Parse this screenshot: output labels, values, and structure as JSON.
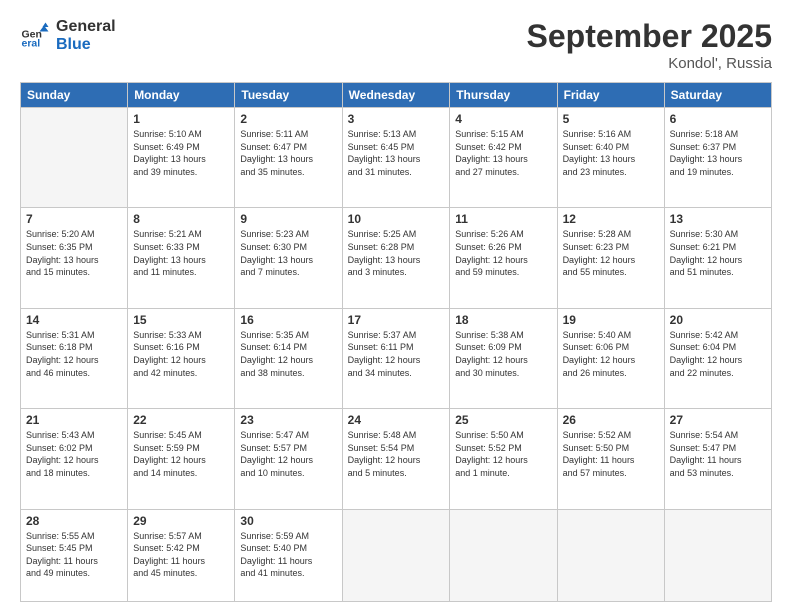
{
  "header": {
    "logo_general": "General",
    "logo_blue": "Blue",
    "month": "September 2025",
    "location": "Kondol', Russia"
  },
  "weekdays": [
    "Sunday",
    "Monday",
    "Tuesday",
    "Wednesday",
    "Thursday",
    "Friday",
    "Saturday"
  ],
  "weeks": [
    [
      {
        "day": "",
        "info": ""
      },
      {
        "day": "1",
        "info": "Sunrise: 5:10 AM\nSunset: 6:49 PM\nDaylight: 13 hours\nand 39 minutes."
      },
      {
        "day": "2",
        "info": "Sunrise: 5:11 AM\nSunset: 6:47 PM\nDaylight: 13 hours\nand 35 minutes."
      },
      {
        "day": "3",
        "info": "Sunrise: 5:13 AM\nSunset: 6:45 PM\nDaylight: 13 hours\nand 31 minutes."
      },
      {
        "day": "4",
        "info": "Sunrise: 5:15 AM\nSunset: 6:42 PM\nDaylight: 13 hours\nand 27 minutes."
      },
      {
        "day": "5",
        "info": "Sunrise: 5:16 AM\nSunset: 6:40 PM\nDaylight: 13 hours\nand 23 minutes."
      },
      {
        "day": "6",
        "info": "Sunrise: 5:18 AM\nSunset: 6:37 PM\nDaylight: 13 hours\nand 19 minutes."
      }
    ],
    [
      {
        "day": "7",
        "info": "Sunrise: 5:20 AM\nSunset: 6:35 PM\nDaylight: 13 hours\nand 15 minutes."
      },
      {
        "day": "8",
        "info": "Sunrise: 5:21 AM\nSunset: 6:33 PM\nDaylight: 13 hours\nand 11 minutes."
      },
      {
        "day": "9",
        "info": "Sunrise: 5:23 AM\nSunset: 6:30 PM\nDaylight: 13 hours\nand 7 minutes."
      },
      {
        "day": "10",
        "info": "Sunrise: 5:25 AM\nSunset: 6:28 PM\nDaylight: 13 hours\nand 3 minutes."
      },
      {
        "day": "11",
        "info": "Sunrise: 5:26 AM\nSunset: 6:26 PM\nDaylight: 12 hours\nand 59 minutes."
      },
      {
        "day": "12",
        "info": "Sunrise: 5:28 AM\nSunset: 6:23 PM\nDaylight: 12 hours\nand 55 minutes."
      },
      {
        "day": "13",
        "info": "Sunrise: 5:30 AM\nSunset: 6:21 PM\nDaylight: 12 hours\nand 51 minutes."
      }
    ],
    [
      {
        "day": "14",
        "info": "Sunrise: 5:31 AM\nSunset: 6:18 PM\nDaylight: 12 hours\nand 46 minutes."
      },
      {
        "day": "15",
        "info": "Sunrise: 5:33 AM\nSunset: 6:16 PM\nDaylight: 12 hours\nand 42 minutes."
      },
      {
        "day": "16",
        "info": "Sunrise: 5:35 AM\nSunset: 6:14 PM\nDaylight: 12 hours\nand 38 minutes."
      },
      {
        "day": "17",
        "info": "Sunrise: 5:37 AM\nSunset: 6:11 PM\nDaylight: 12 hours\nand 34 minutes."
      },
      {
        "day": "18",
        "info": "Sunrise: 5:38 AM\nSunset: 6:09 PM\nDaylight: 12 hours\nand 30 minutes."
      },
      {
        "day": "19",
        "info": "Sunrise: 5:40 AM\nSunset: 6:06 PM\nDaylight: 12 hours\nand 26 minutes."
      },
      {
        "day": "20",
        "info": "Sunrise: 5:42 AM\nSunset: 6:04 PM\nDaylight: 12 hours\nand 22 minutes."
      }
    ],
    [
      {
        "day": "21",
        "info": "Sunrise: 5:43 AM\nSunset: 6:02 PM\nDaylight: 12 hours\nand 18 minutes."
      },
      {
        "day": "22",
        "info": "Sunrise: 5:45 AM\nSunset: 5:59 PM\nDaylight: 12 hours\nand 14 minutes."
      },
      {
        "day": "23",
        "info": "Sunrise: 5:47 AM\nSunset: 5:57 PM\nDaylight: 12 hours\nand 10 minutes."
      },
      {
        "day": "24",
        "info": "Sunrise: 5:48 AM\nSunset: 5:54 PM\nDaylight: 12 hours\nand 5 minutes."
      },
      {
        "day": "25",
        "info": "Sunrise: 5:50 AM\nSunset: 5:52 PM\nDaylight: 12 hours\nand 1 minute."
      },
      {
        "day": "26",
        "info": "Sunrise: 5:52 AM\nSunset: 5:50 PM\nDaylight: 11 hours\nand 57 minutes."
      },
      {
        "day": "27",
        "info": "Sunrise: 5:54 AM\nSunset: 5:47 PM\nDaylight: 11 hours\nand 53 minutes."
      }
    ],
    [
      {
        "day": "28",
        "info": "Sunrise: 5:55 AM\nSunset: 5:45 PM\nDaylight: 11 hours\nand 49 minutes."
      },
      {
        "day": "29",
        "info": "Sunrise: 5:57 AM\nSunset: 5:42 PM\nDaylight: 11 hours\nand 45 minutes."
      },
      {
        "day": "30",
        "info": "Sunrise: 5:59 AM\nSunset: 5:40 PM\nDaylight: 11 hours\nand 41 minutes."
      },
      {
        "day": "",
        "info": ""
      },
      {
        "day": "",
        "info": ""
      },
      {
        "day": "",
        "info": ""
      },
      {
        "day": "",
        "info": ""
      }
    ]
  ]
}
